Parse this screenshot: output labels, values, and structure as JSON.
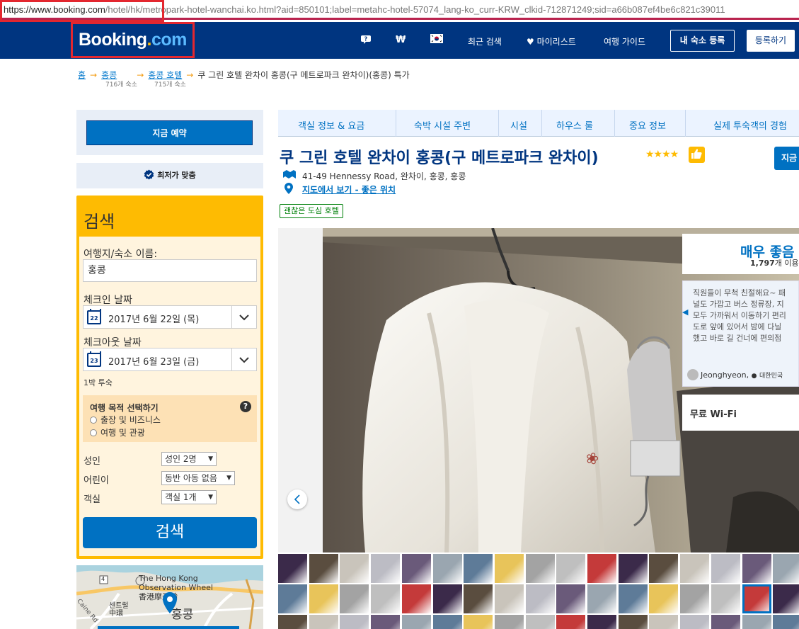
{
  "browser": {
    "url_host": "https://www.booking.com",
    "url_path": "/hotel/hk/metropark-hotel-wanchai.ko.html?aid=850101;label=metahc-hotel-57074_lang-ko_curr-KRW_clkid-712871249;sid=a66b087ef4be6c821c39011"
  },
  "header": {
    "logo_main": "Booking",
    "logo_dot": ".",
    "logo_com": "com",
    "help_icon": "help-chat-icon",
    "currency": "₩",
    "language_flag": "korea-flag-icon",
    "recent_searches": "최근 검색",
    "wishlist": "마이리스트",
    "travel_guide": "여행 가이드",
    "list_property": "내 숙소 등록",
    "register": "등록하기"
  },
  "breadcrumb": {
    "home": "홈",
    "city": "홍콩",
    "city_count": "716개 숙소",
    "hotels": "홍콩 호텔",
    "hotels_count": "715개 숙소",
    "current": "쿠 그린 호텔 완차이 홍콩(구 메트로파크 완차이)(홍콩) 특가"
  },
  "sidebar": {
    "book_now": "지금 예약",
    "price_match": "최저가 맞춤",
    "search": {
      "title": "검색",
      "destination_label": "여행지/숙소 이름:",
      "destination_value": "홍콩",
      "checkin_label": "체크인 날짜",
      "checkin_day": "22",
      "checkin_value": "2017년 6월 22일 (목)",
      "checkout_label": "체크아웃 날짜",
      "checkout_day": "23",
      "checkout_value": "2017년 6월 23일 (금)",
      "nights": "1박 투숙",
      "purpose_title": "여행 목적 선택하기",
      "purpose_help": "?",
      "purpose_business": "출장 및 비즈니스",
      "purpose_leisure": "여행 및 관광",
      "adults_label": "성인",
      "adults_value": "성인 2명",
      "children_label": "어린이",
      "children_value": "동반 아동 없음",
      "rooms_label": "객실",
      "rooms_value": "객실 1개",
      "search_button": "검색"
    },
    "map": {
      "label_observation_1": "The Hong Kong",
      "label_observation_2": "Observation Wheel",
      "label_observation_3": "香港摩天輪",
      "label_central_1": "센트럴",
      "label_central_2": "中環",
      "label_hk": "홍콩",
      "label_road": "Caine Rd",
      "route_number": "4"
    }
  },
  "tabs": [
    {
      "label": "객실 정보 & 요금"
    },
    {
      "label": "숙박 시설 주변"
    },
    {
      "label": "시설"
    },
    {
      "label": "하우스 룰"
    },
    {
      "label": "중요 정보"
    },
    {
      "label": "실제 투숙객의 경험"
    }
  ],
  "hotel": {
    "title": "쿠 그린 호텔 완차이 홍콩(구 메트로파크 완차이)",
    "stars": "★★★★",
    "address": "41-49 Hennessy Road, 완차이, 홍콩, 홍콩",
    "map_link": "지도에서 보기 - 좋은 위치",
    "badge": "괜찮은 도심 호텔",
    "reserve_edge": "지금"
  },
  "gallery": {
    "score_word": "매우 좋음",
    "review_count": "1,797",
    "review_count_suffix": "개 이용",
    "review_lines": [
      "직원들이 무척 친절해요~ 패",
      "널도 가깝고 버스 정류장, 지",
      "모두 가까워서 이동하기 편리",
      "도로 앞에 있어서 밤에 다닐",
      "했고 바로 길 건너에 편의점"
    ],
    "review_author": "Jeonghyeon,",
    "review_country": "대한민국",
    "highlight": "무료 Wi-Fi"
  },
  "colors": {
    "brand_navy": "#003580",
    "brand_blue": "#0071c2",
    "brand_yellow": "#febb02",
    "highlight_red": "#e3272f"
  }
}
